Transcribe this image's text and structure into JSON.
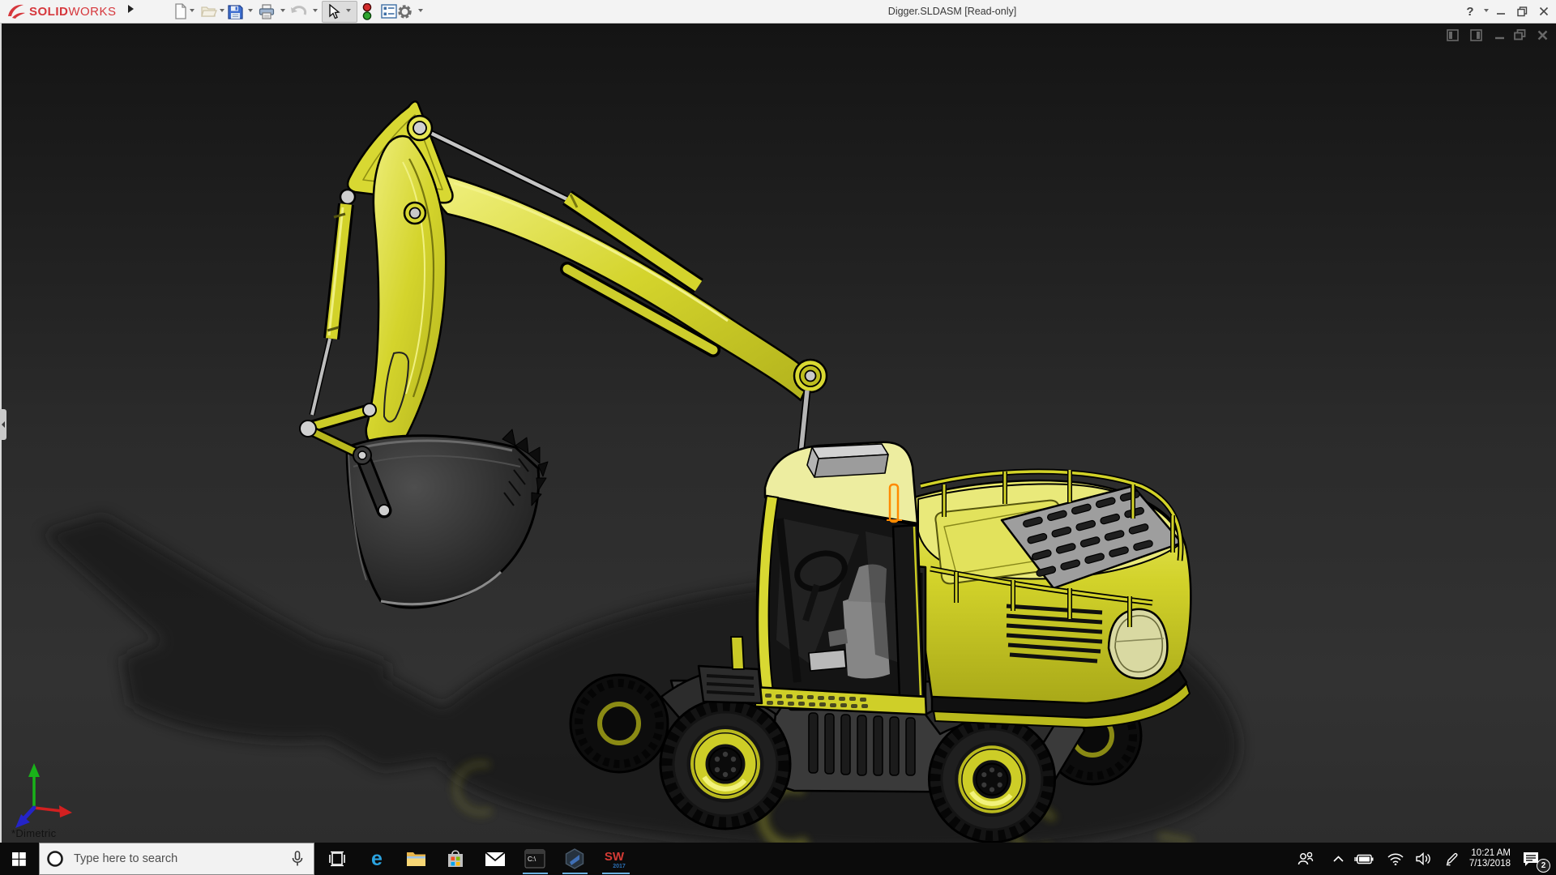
{
  "titlebar": {
    "brand": {
      "part1": "SOLID",
      "part2": "WORKS"
    },
    "title": "Digger.SLDASM [Read-only]",
    "help_label": "?",
    "tools": [
      {
        "name": "new",
        "icon": "new-document-icon",
        "has_dropdown": true,
        "enabled": true
      },
      {
        "name": "open",
        "icon": "open-folder-icon",
        "has_dropdown": true,
        "enabled": false
      },
      {
        "name": "save",
        "icon": "save-floppy-icon",
        "has_dropdown": true,
        "enabled": true
      },
      {
        "name": "print",
        "icon": "print-icon",
        "has_dropdown": true,
        "enabled": true
      },
      {
        "name": "undo",
        "icon": "undo-icon",
        "has_dropdown": true,
        "enabled": false
      },
      {
        "name": "select",
        "icon": "select-cursor-icon",
        "has_dropdown": true,
        "enabled": true,
        "state": "pressed"
      },
      {
        "name": "rebuild",
        "icon": "stoplight-icon",
        "has_dropdown": false,
        "enabled": true
      },
      {
        "name": "file-properties",
        "icon": "properties-list-icon",
        "has_dropdown": false,
        "enabled": true
      },
      {
        "name": "options",
        "icon": "gear-icon",
        "has_dropdown": true,
        "enabled": true
      }
    ],
    "window_controls": [
      "help",
      "minimize",
      "restore",
      "close"
    ]
  },
  "viewport": {
    "orientation_label": "*Dimetric",
    "background_color": "#2a2a2a",
    "selection_color": "#ff8a00",
    "document_controls": [
      "pane-left",
      "pane-right",
      "minimize",
      "restore",
      "close"
    ],
    "triad": {
      "x_color": "#d22020",
      "y_color": "#19b219",
      "z_color": "#2424c8"
    },
    "model": {
      "name": "Digger excavator assembly",
      "body_color": "#d8d832",
      "edge_color": "#000000",
      "bucket_color": "#2b2b2b",
      "metal_color": "#c2c2c2",
      "selected_edge": "cab front pillar edge"
    }
  },
  "taskbar": {
    "search_placeholder": "Type here to search",
    "apps": [
      {
        "name": "task-view",
        "running": false
      },
      {
        "name": "edge",
        "glyph": "e",
        "running": false
      },
      {
        "name": "file-explorer",
        "running": false
      },
      {
        "name": "store",
        "running": false
      },
      {
        "name": "mail",
        "running": false
      },
      {
        "name": "command-prompt",
        "glyph": "C:\\",
        "running": true
      },
      {
        "name": "hex-app",
        "running": true
      },
      {
        "name": "solidworks-2017",
        "glyph1": "SW",
        "glyph2": "2017",
        "running": true
      }
    ],
    "tray": {
      "time": "10:21 AM",
      "date": "7/13/2018",
      "notification_count": "2"
    }
  }
}
